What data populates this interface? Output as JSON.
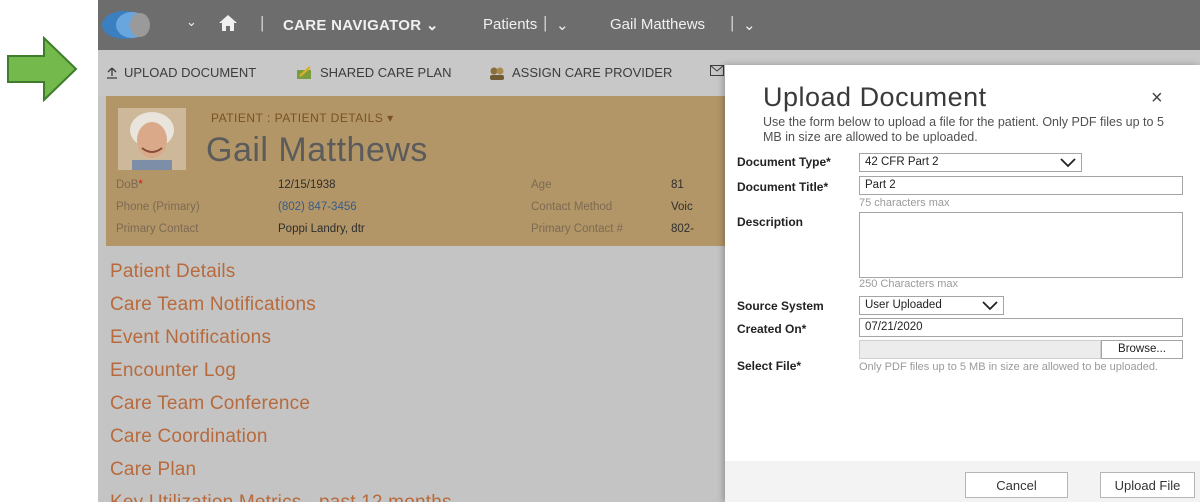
{
  "topnav": {
    "care_navigator": "CARE NAVIGATOR",
    "patients": "Patients",
    "patient_name": "Gail Matthews"
  },
  "commands": {
    "upload": "UPLOAD DOCUMENT",
    "shared_plan": "SHARED CARE PLAN",
    "assign_provider": "ASSIGN CARE PROVIDER"
  },
  "patient": {
    "breadcrumb": "PATIENT : PATIENT DETAILS",
    "name": "Gail Matthews",
    "fields": {
      "dob_label": "DoB",
      "dob": "12/15/1938",
      "age_label": "Age",
      "age": "81",
      "phone_label": "Phone (Primary)",
      "phone": "(802) 847-3456",
      "contact_method_label": "Contact Method",
      "contact_method": "Voic",
      "primary_contact_label": "Primary Contact",
      "primary_contact": "Poppi Landry, dtr",
      "primary_contact_num_label": "Primary Contact #",
      "primary_contact_num": "802-"
    }
  },
  "side_links": [
    "Patient Details",
    "Care Team Notifications",
    "Event Notifications",
    "Encounter Log",
    "Care Team Conference",
    "Care Coordination",
    "Care Plan",
    "Key Utilization Metrics - past 12 months"
  ],
  "modal": {
    "title": "Upload Document",
    "close": "×",
    "instructions": "Use the form below to upload a file for the patient. Only PDF files up to 5 MB in size are allowed to be uploaded.",
    "document_type_label": "Document Type*",
    "document_type_value": "42 CFR Part 2",
    "document_title_label": "Document Title*",
    "document_title_value": "Part 2",
    "title_hint": "75 characters max",
    "description_label": "Description",
    "description_hint": "250 Characters max",
    "source_system_label": "Source System",
    "source_system_value": "User Uploaded",
    "created_on_label": "Created On*",
    "created_on_value": "07/21/2020",
    "browse_label": "Browse...",
    "select_file_label": "Select File*",
    "file_hint": "Only PDF files up to 5 MB in size are allowed to be uploaded.",
    "cancel_label": "Cancel",
    "upload_label": "Upload File"
  },
  "colors": {
    "arrow": "#74b94b",
    "topnav_bg": "#6d6d6d",
    "overlay_bg": "#c4c4c4",
    "patient_card_bg": "#b29667",
    "link_orange": "#b86a3c"
  }
}
